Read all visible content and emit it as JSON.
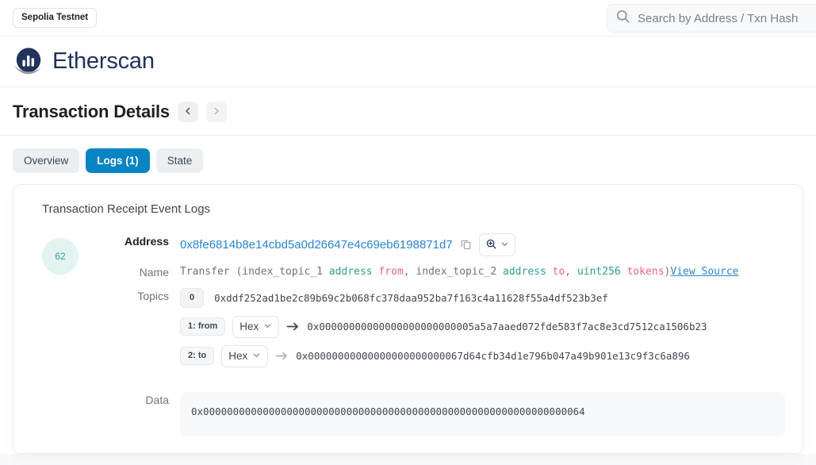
{
  "topbar": {
    "network_label": "Sepolia Testnet",
    "search": {
      "placeholder": "Search by Address / Txn Hash",
      "icon": "search-icon",
      "value": ""
    }
  },
  "brand": {
    "name": "Etherscan",
    "logo_icon": "etherscan-logo-icon",
    "color": "#21325b"
  },
  "page": {
    "title": "Transaction Details",
    "prev_icon": "chevron-left-icon",
    "next_icon": "chevron-right-icon"
  },
  "tabs": [
    {
      "label": "Overview",
      "active": false
    },
    {
      "label": "Logs (1)",
      "active": true
    },
    {
      "label": "State",
      "active": false
    }
  ],
  "card": {
    "title": "Transaction Receipt Event Logs"
  },
  "log": {
    "index": "62",
    "index_color": "#32a1a1",
    "index_bg": "#e3f3f1",
    "address_label": "Address",
    "address_value": "0x8fe6814b8e14cbd5a0d26647e4c69eb6198871d7",
    "copy_icon": "copy-icon",
    "zoom_icon": "magnifier-plus-icon",
    "zoom_chevron_icon": "chevron-down-icon",
    "name_label": "Name",
    "name_signature": {
      "part1": "Transfer (index_topic_1 ",
      "type1": "address",
      "param1": " from",
      "sep1": ", index_topic_2 ",
      "type2": "address",
      "param2": " to",
      "sep2": ", ",
      "type3": "uint256",
      "param3": " tokens",
      "closing": ")",
      "view_source": "View Source"
    },
    "topics_label": "Topics",
    "topics": [
      {
        "badge": "0",
        "badge_style": "plain",
        "has_select": false,
        "value": "0xddf252ad1be2c89b69c2b068fc378daa952ba7f163c4a11628f55a4df523b3ef"
      },
      {
        "badge": "1: from",
        "badge_style": "named",
        "has_select": true,
        "select_value": "Hex",
        "arrow_icon": "arrow-right-icon",
        "arrow_color": "#3f4750",
        "value": "0x00000000000000000000000005a5a7aaed072fde583f7ac8e3cd7512ca1506b23"
      },
      {
        "badge": "2: to",
        "badge_style": "named",
        "has_select": true,
        "select_value": "Hex",
        "arrow_icon": "arrow-right-icon",
        "arrow_color": "#adb5bd",
        "value": "0x00000000000000000000000067d64cfb34d1e796b047a49b901e13c9f3c6a896"
      }
    ],
    "data_label": "Data",
    "data_value": "0x0000000000000000000000000000000000000000000000000000000000000064"
  },
  "colors": {
    "accent": "#0784c3",
    "link": "#2a85d0",
    "type": "#2f9e8f",
    "param": "#e8647c",
    "muted": "#6c757d",
    "page_bg": "#f8f9fa"
  }
}
